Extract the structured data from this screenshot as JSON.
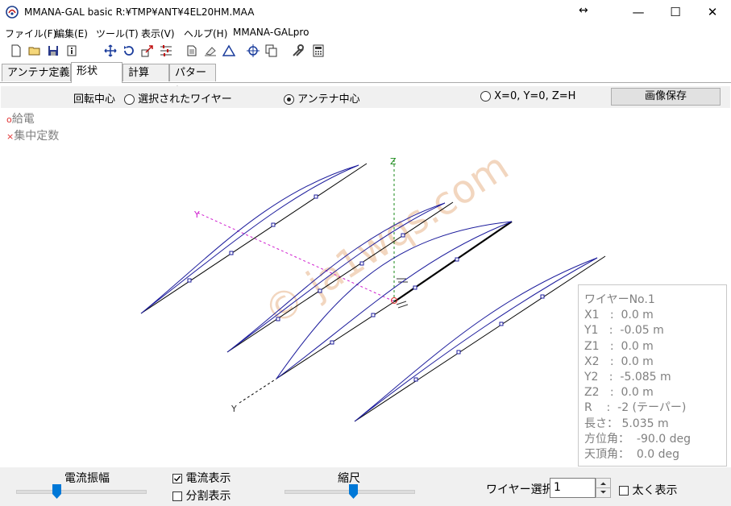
{
  "window": {
    "title": "MMANA-GAL basic R:¥TMP¥ANT¥4EL20HM.MAA",
    "resize_glyph": "↔",
    "minimize": "—",
    "maximize": "☐",
    "close": "✕"
  },
  "menu": [
    "ファイル(F)",
    "編集(E)",
    "ツール(T)",
    "表示(V)",
    "ヘルプ(H)",
    "MMANA-GALpro"
  ],
  "toolbar_icons": [
    "new-file-icon",
    "open-folder-icon",
    "save-icon",
    "info-icon",
    "move-icon",
    "rotate-icon",
    "zoom-icon",
    "sliders-icon",
    "document-icon",
    "eraser-icon",
    "triangle-icon",
    "target-icon",
    "copy-icon",
    "tools-icon",
    "calculator-icon"
  ],
  "tabs": [
    "アンテナ定義",
    "形状",
    "計算",
    "パターン"
  ],
  "active_tab": "形状",
  "view": {
    "rotation_label": "回転中心",
    "opt_selected_wire": "選択されたワイヤー",
    "opt_antenna_center": "アンテナ中心",
    "opt_origin": "X=0, Y=0, Z=H",
    "selected": "アンテナ中心",
    "save_image": "画像保存"
  },
  "legend": {
    "feed_symbol": "o",
    "feed_label": "給電",
    "load_symbol": "×",
    "load_label": "集中定数",
    "feed_color": "#e03030"
  },
  "axes": {
    "z": "Z",
    "y_top": "Y",
    "y_bottom": "Y"
  },
  "watermark": "© ja1wqs.com",
  "wire_info": {
    "title": "ワイヤーNo.1",
    "lines": [
      "X1   :  0.0 m",
      "Y1   :  -0.05 m",
      "Z1   :  0.0 m",
      "X2   :  0.0 m",
      "Y2   :  -5.085 m",
      "Z2   :  0.0 m",
      "R    :  -2 (テーパー)",
      "長さ： 5.035 m",
      "方位角：  -90.0 deg",
      "天頂角：  0.0 deg"
    ]
  },
  "bottom": {
    "current_amplitude": "電流振幅",
    "show_current": "電流表示",
    "show_current_checked": true,
    "show_segments": "分割表示",
    "show_segments_checked": false,
    "scale": "縮尺",
    "wire_select_label": "ワイヤー選択",
    "wire_select_value": "1",
    "bold_display": "太く表示",
    "bold_display_checked": false
  },
  "colors": {
    "accent": "#0078d7",
    "wire": "#000000",
    "current": "#1c1c9c",
    "z_axis": "#1a8a1a",
    "y_axis": "#d020d0"
  }
}
